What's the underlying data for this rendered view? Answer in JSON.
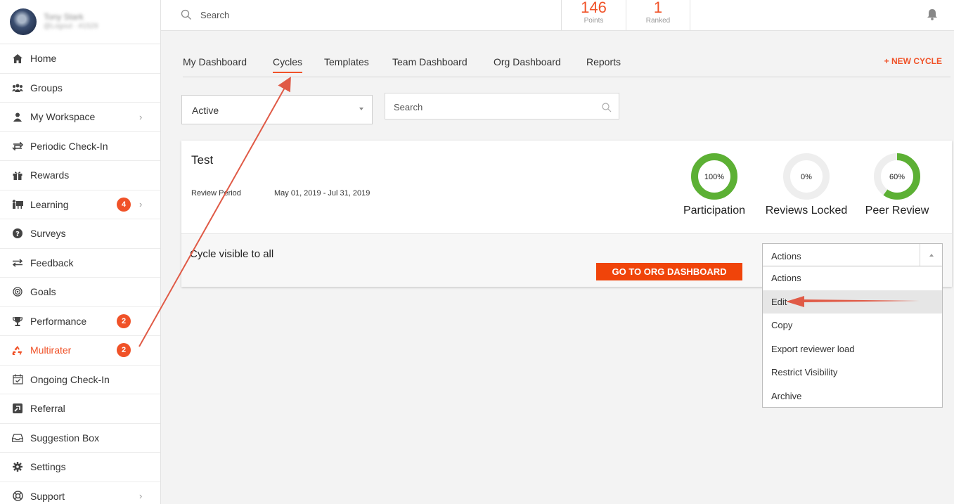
{
  "profile": {
    "name": "Tony Stark",
    "subtitle": "@Logout · #1529"
  },
  "sidebar": {
    "items": [
      {
        "label": "Home",
        "icon": "home-icon"
      },
      {
        "label": "Groups",
        "icon": "groups-icon"
      },
      {
        "label": "My Workspace",
        "icon": "workspace-icon"
      },
      {
        "label": "Periodic Check-In",
        "icon": "checkin-icon"
      },
      {
        "label": "Rewards",
        "icon": "gift-icon"
      },
      {
        "label": "Learning",
        "icon": "learning-icon",
        "badge": "4"
      },
      {
        "label": "Surveys",
        "icon": "question-icon"
      },
      {
        "label": "Feedback",
        "icon": "feedback-icon"
      },
      {
        "label": "Goals",
        "icon": "target-icon"
      },
      {
        "label": "Performance",
        "icon": "trophy-icon",
        "badge": "2"
      },
      {
        "label": "Multirater",
        "icon": "recycle-icon",
        "badge": "2"
      },
      {
        "label": "Ongoing Check-In",
        "icon": "calendar-check-icon"
      },
      {
        "label": "Referral",
        "icon": "referral-icon"
      },
      {
        "label": "Suggestion Box",
        "icon": "inbox-icon"
      },
      {
        "label": "Settings",
        "icon": "gear-icon"
      },
      {
        "label": "Support",
        "icon": "lifebuoy-icon"
      }
    ]
  },
  "topbar": {
    "search_placeholder": "Search",
    "points_value": "146",
    "points_label": "Points",
    "ranked_value": "1",
    "ranked_label": "Ranked"
  },
  "tabs": [
    "My Dashboard",
    "Cycles",
    "Templates",
    "Team Dashboard",
    "Org Dashboard",
    "Reports"
  ],
  "new_cycle_label": "+ NEW CYCLE",
  "filter": {
    "selected": "Active",
    "search_placeholder": "Search"
  },
  "cycle": {
    "title": "Test",
    "review_period_label": "Review Period",
    "review_period_value": "May 01, 2019 - Jul 31, 2019",
    "metrics": [
      {
        "label": "Participation",
        "value_text": "100%",
        "value": 1.0
      },
      {
        "label": "Reviews Locked",
        "value_text": "0%",
        "value": 0.0
      },
      {
        "label": "Peer Review",
        "value_text": "60%",
        "value": 0.6
      }
    ],
    "visibility_text": "Cycle visible to all",
    "goto_button": "GO TO ORG DASHBOARD"
  },
  "actions": {
    "selected": "Actions",
    "options": [
      "Actions",
      "Edit",
      "Copy",
      "Export reviewer load",
      "Restrict Visibility",
      "Archive"
    ],
    "highlighted": "Edit"
  },
  "colors": {
    "accent": "#f05228",
    "ring_green": "#5cb034",
    "ring_track": "#eeeeee",
    "annotation_arrow": "#e05a46"
  }
}
